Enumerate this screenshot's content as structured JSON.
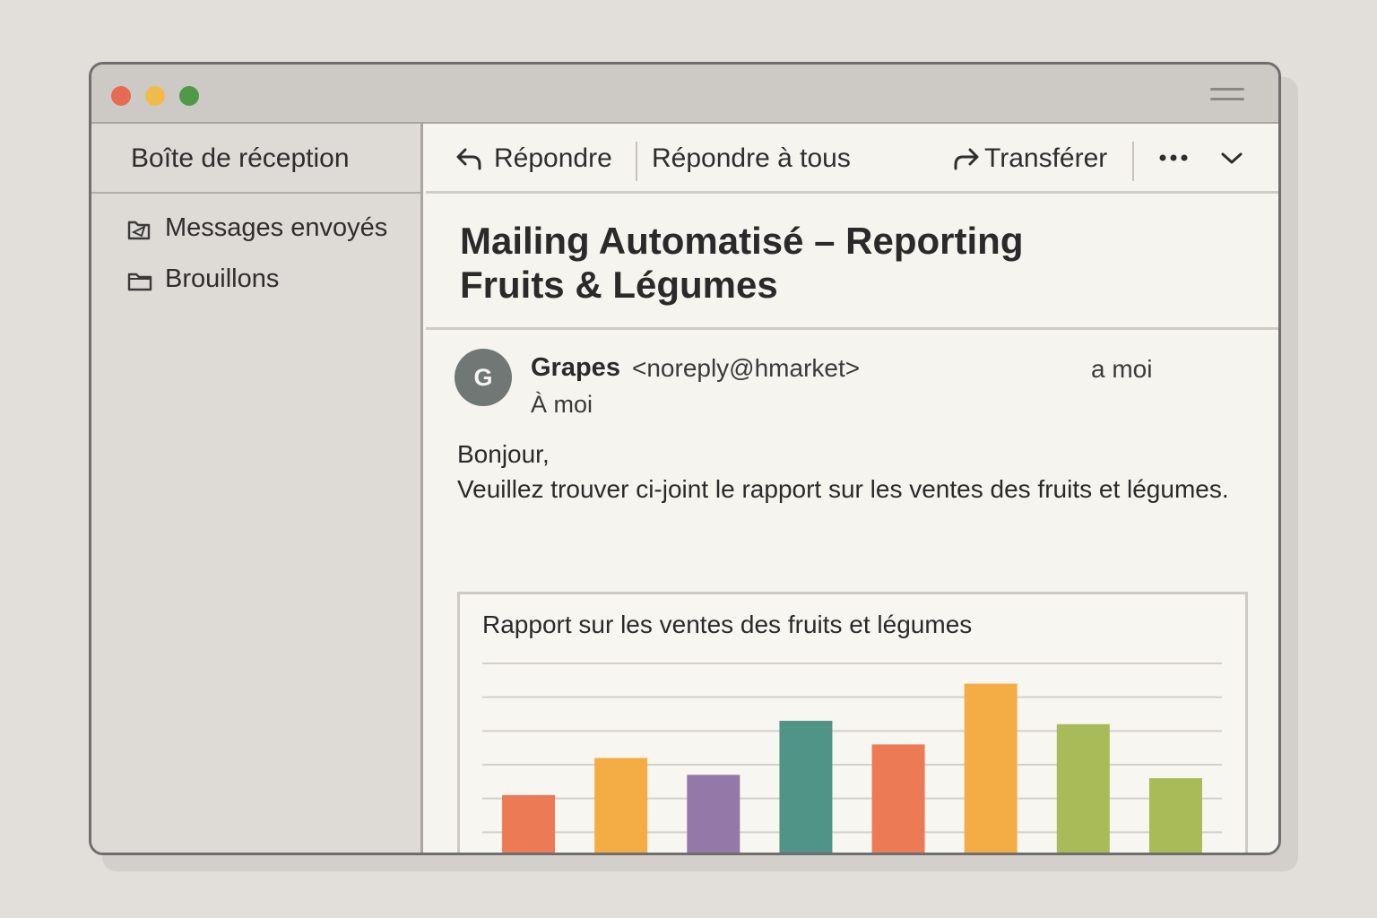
{
  "sidebar": {
    "header": "Boîte de réception",
    "items": [
      {
        "label": "Messages envoyés",
        "icon": "sent-folder-icon"
      },
      {
        "label": "Brouillons",
        "icon": "folder-icon"
      }
    ]
  },
  "toolbar": {
    "reply_label": "Répondre",
    "reply_all_label": "Répondre à tous",
    "forward_label": "Transférer",
    "more_icon": "more-icon",
    "chevron_icon": "chevron-down-icon"
  },
  "email": {
    "subject_line1": "Mailing Automatisé – Reporting",
    "subject_line2": "Fruits & Légumes",
    "avatar_letter": "G",
    "sender_name": "Grapes",
    "sender_email": "<noreply@hmarket>",
    "to": "À moi",
    "to_right": "a  moi",
    "greeting": "Bonjour,",
    "body": "Veuillez trouver ci-joint le rapport sur les ventes des fruits et légumes."
  },
  "colors": {
    "traffic_red": "#e76a52",
    "traffic_yellow": "#f0bb4b",
    "traffic_green": "#4e9a48"
  },
  "chart_data": {
    "type": "bar",
    "title": "Rapport sur les ventes des fruits et légumes",
    "grid": true,
    "ylim": [
      0,
      6
    ],
    "values": [
      2.1,
      3.2,
      2.7,
      4.3,
      3.6,
      5.4,
      4.2,
      2.6
    ],
    "colors": [
      "#ec7a55",
      "#f4ad45",
      "#9479a8",
      "#4f9486",
      "#ec7a55",
      "#f4ad45",
      "#a9bb58",
      "#a9bb58"
    ]
  }
}
